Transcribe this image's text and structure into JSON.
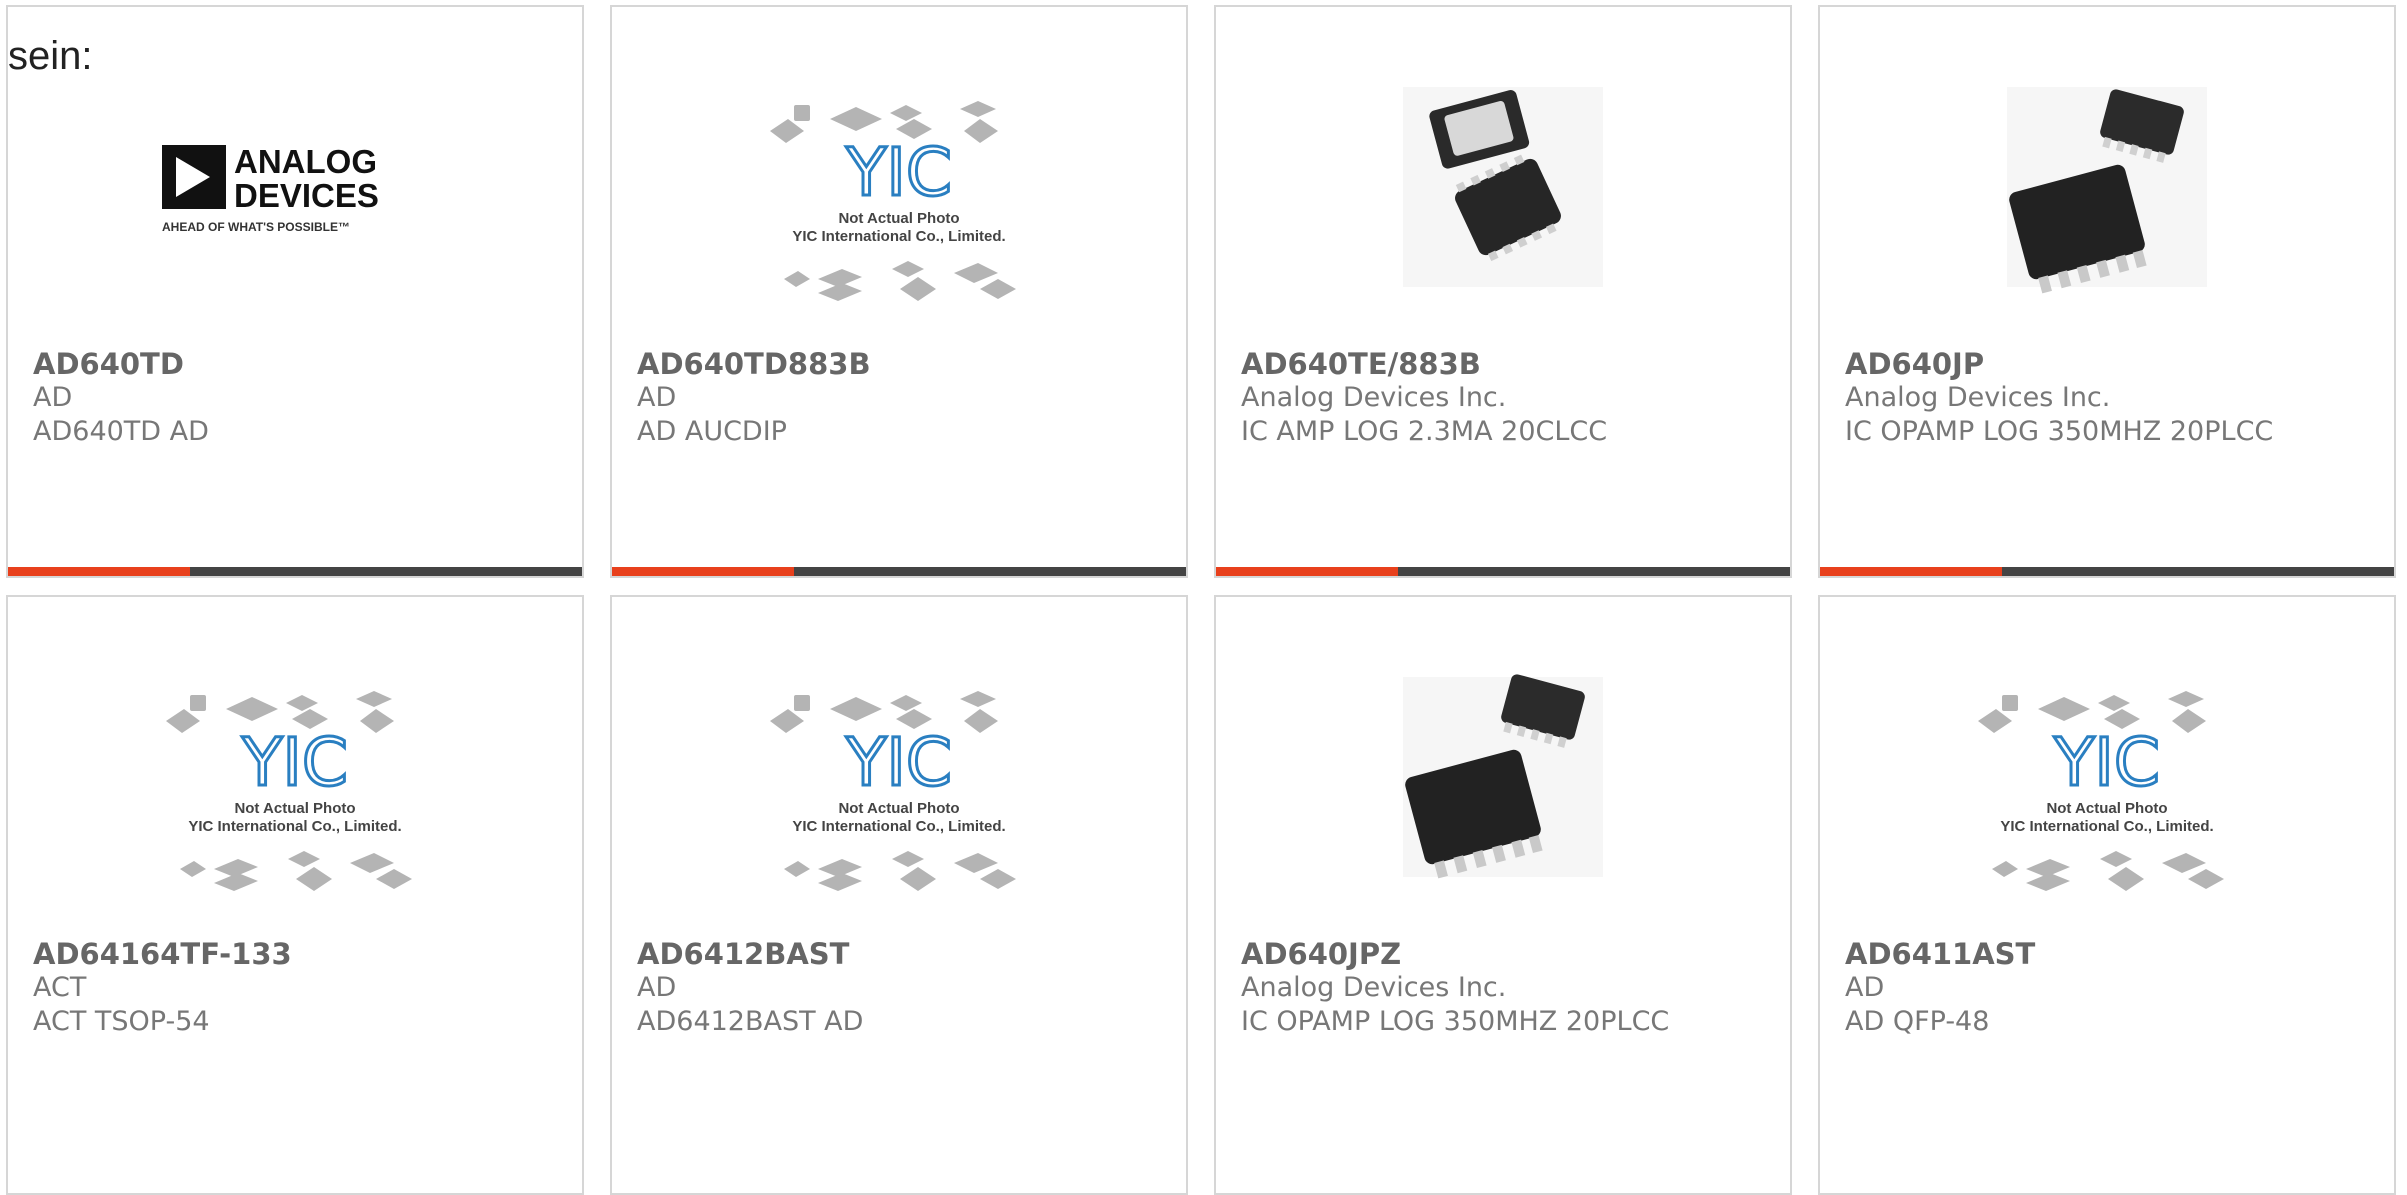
{
  "intro_text": "sein:",
  "colors": {
    "accent": "#e8401c",
    "bar": "#444444",
    "border": "#d6d6d6"
  },
  "placeholder": {
    "line1": "Not Actual Photo",
    "line2": "YIC International Co., Limited.",
    "logo": "YIC"
  },
  "ad_logo": {
    "line1": "ANALOG",
    "line2": "DEVICES",
    "tagline": "AHEAD OF WHAT'S POSSIBLE™"
  },
  "products": [
    {
      "part": "AD640TD",
      "mfr": "AD",
      "desc": "AD640TD AD",
      "image": "analog-devices-logo"
    },
    {
      "part": "AD640TD883B",
      "mfr": "AD",
      "desc": "AD AUCDIP",
      "image": "yic-placeholder"
    },
    {
      "part": "AD640TE/883B",
      "mfr": "Analog Devices Inc.",
      "desc": "IC AMP LOG 2.3MA 20CLCC",
      "image": "clcc-chip-photo"
    },
    {
      "part": "AD640JP",
      "mfr": "Analog Devices Inc.",
      "desc": "IC OPAMP LOG 350MHZ 20PLCC",
      "image": "plcc-chip-photo"
    },
    {
      "part": "AD64164TF-133",
      "mfr": "ACT",
      "desc": "ACT TSOP-54",
      "image": "yic-placeholder"
    },
    {
      "part": "AD6412BAST",
      "mfr": "AD",
      "desc": "AD6412BAST AD",
      "image": "yic-placeholder"
    },
    {
      "part": "AD640JPZ",
      "mfr": "Analog Devices Inc.",
      "desc": "IC OPAMP LOG 350MHZ 20PLCC",
      "image": "plcc-chip-photo"
    },
    {
      "part": "AD6411AST",
      "mfr": "AD",
      "desc": "AD QFP-48",
      "image": "yic-placeholder"
    }
  ]
}
